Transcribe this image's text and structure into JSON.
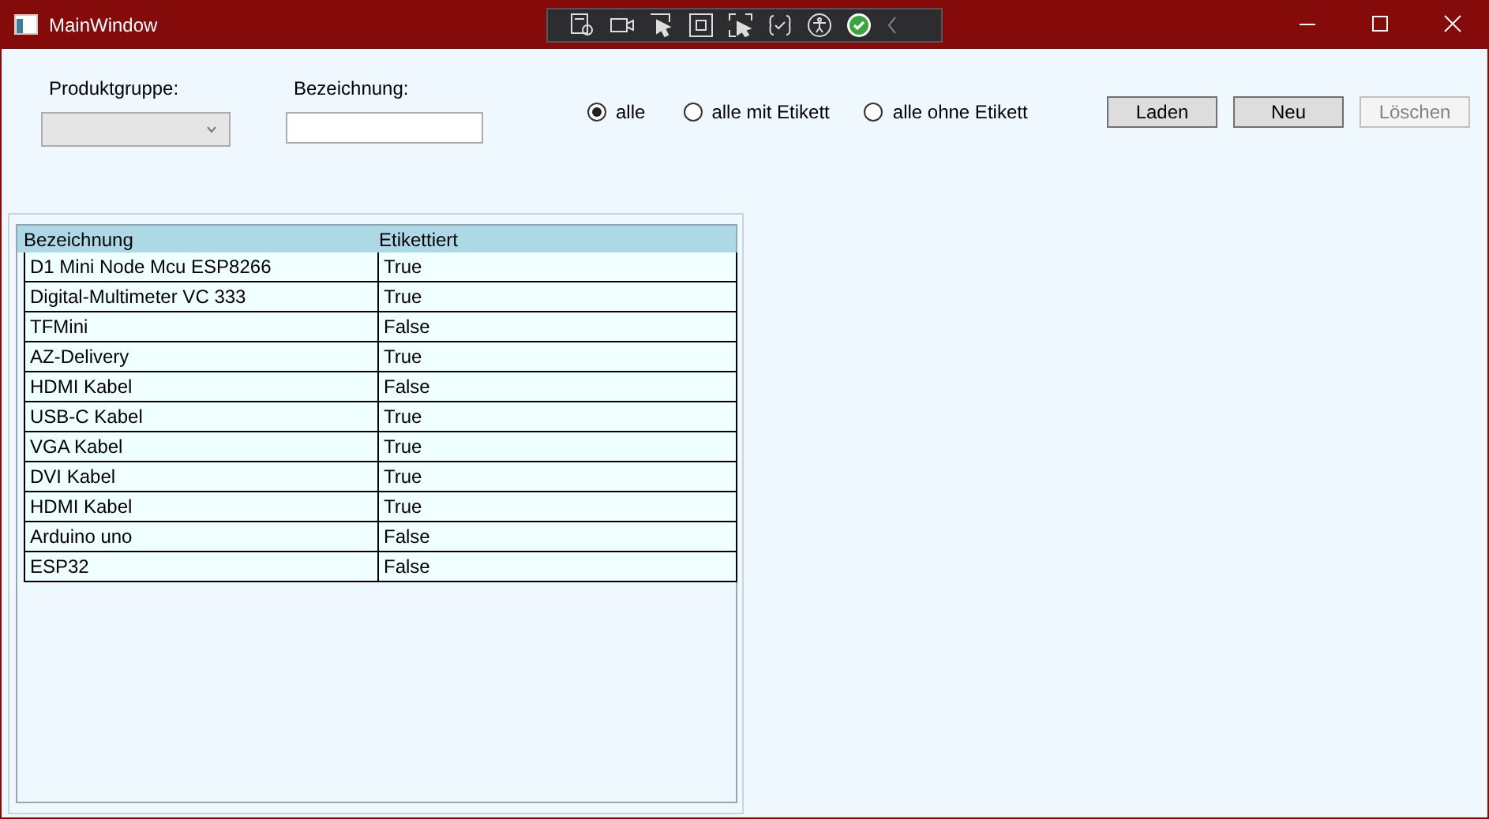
{
  "window": {
    "title": "MainWindow"
  },
  "filters": {
    "produktgruppe_label": "Produktgruppe:",
    "bezeichnung_label": "Bezeichnung:"
  },
  "radios": [
    {
      "label": "alle",
      "selected": true
    },
    {
      "label": "alle mit Etikett",
      "selected": false
    },
    {
      "label": "alle ohne Etikett",
      "selected": false
    }
  ],
  "buttons": [
    {
      "label": "Laden",
      "disabled": false
    },
    {
      "label": "Neu",
      "disabled": false
    },
    {
      "label": "Löschen",
      "disabled": true
    }
  ],
  "table": {
    "columns": [
      "Bezeichnung",
      "Etikettiert"
    ],
    "rows": [
      [
        "D1 Mini Node Mcu ESP8266",
        "True"
      ],
      [
        "Digital-Multimeter VC 333",
        "True"
      ],
      [
        "TFMini",
        "False"
      ],
      [
        "AZ-Delivery",
        "True"
      ],
      [
        "HDMI Kabel",
        "False"
      ],
      [
        "USB-C Kabel",
        "True"
      ],
      [
        "VGA Kabel",
        "True"
      ],
      [
        "DVI Kabel",
        "True"
      ],
      [
        "HDMI Kabel",
        "True"
      ],
      [
        "Arduino uno",
        "False"
      ],
      [
        "ESP32",
        "False"
      ]
    ]
  }
}
